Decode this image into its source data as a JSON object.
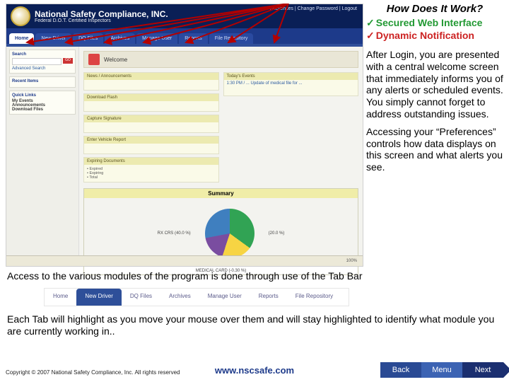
{
  "slide": {
    "title": "How Does It Work?",
    "features": [
      "Secured Web Interface",
      "Dynamic Notification"
    ],
    "para1": "After Login, you are presented with a central welcome screen that immediately informs you of any alerts or scheduled events. You simply cannot forget to address outstanding issues.",
    "para2": "Accessing your “Preferences” controls how data displays on this screen and what alerts you see.",
    "desc1": "Access to the various modules of the program is done through use of the Tab Bar",
    "desc2": "Each Tab will highlight as you move your mouse over them and will stay highlighted to identify what module you are currently working in..",
    "copyright": "Copyright © 2007 National Safety Compliance, Inc. All rights reserved",
    "site": "www.nscsafe.com"
  },
  "nav": {
    "back": "Back",
    "menu": "Menu",
    "next": "Next"
  },
  "app": {
    "brand_title": "National Safety Compliance, INC.",
    "brand_sub": "Federal D.O.T. Certified Inspectors",
    "header_links": "Preferences | Change Password | Logout",
    "tabs": [
      "Home",
      "New Driver",
      "DQ Files",
      "Archives",
      "Manage User",
      "Reports",
      "File Repository"
    ],
    "active_tab_index": 0,
    "left": {
      "search": "Search",
      "go": "GO",
      "advanced": "Advanced Search",
      "recent": "Recent Items",
      "quick": "Quick Links",
      "links": [
        "My Events",
        "Announcements",
        "Download Files"
      ]
    },
    "welcome": "Welcome",
    "left_boxes": [
      {
        "h": "News / Announcements",
        "b": ""
      },
      {
        "h": "Download Flash",
        "b": ""
      },
      {
        "h": "Capture Signature",
        "b": ""
      },
      {
        "h": "Enter Vehicle Report",
        "b": ""
      }
    ],
    "expiring": {
      "h": "Expiring Documents",
      "rows": [
        "• Expired",
        "• Expiring",
        "• Total"
      ]
    },
    "today": {
      "h": "Today's Events",
      "item": "1:30 PM / ...\nUpdate of medical file for ..."
    },
    "summary": {
      "h": "Summary",
      "left_label": "RX CRS (40.0 %)",
      "right_label": "(20.0 %)",
      "bottom_label": "MEDICAL CARD (-0.30 %)"
    },
    "statusbar": {
      "zoom": "100%"
    }
  },
  "tabbar2": {
    "tabs": [
      "Home",
      "New Driver",
      "DQ Files",
      "Archives",
      "Manage User",
      "Reports",
      "File Repository"
    ],
    "active_index": 1
  },
  "colors": {
    "accent": "#1d3a8a",
    "green": "#229933",
    "red": "#cc2222",
    "arrow": "#b30000"
  }
}
